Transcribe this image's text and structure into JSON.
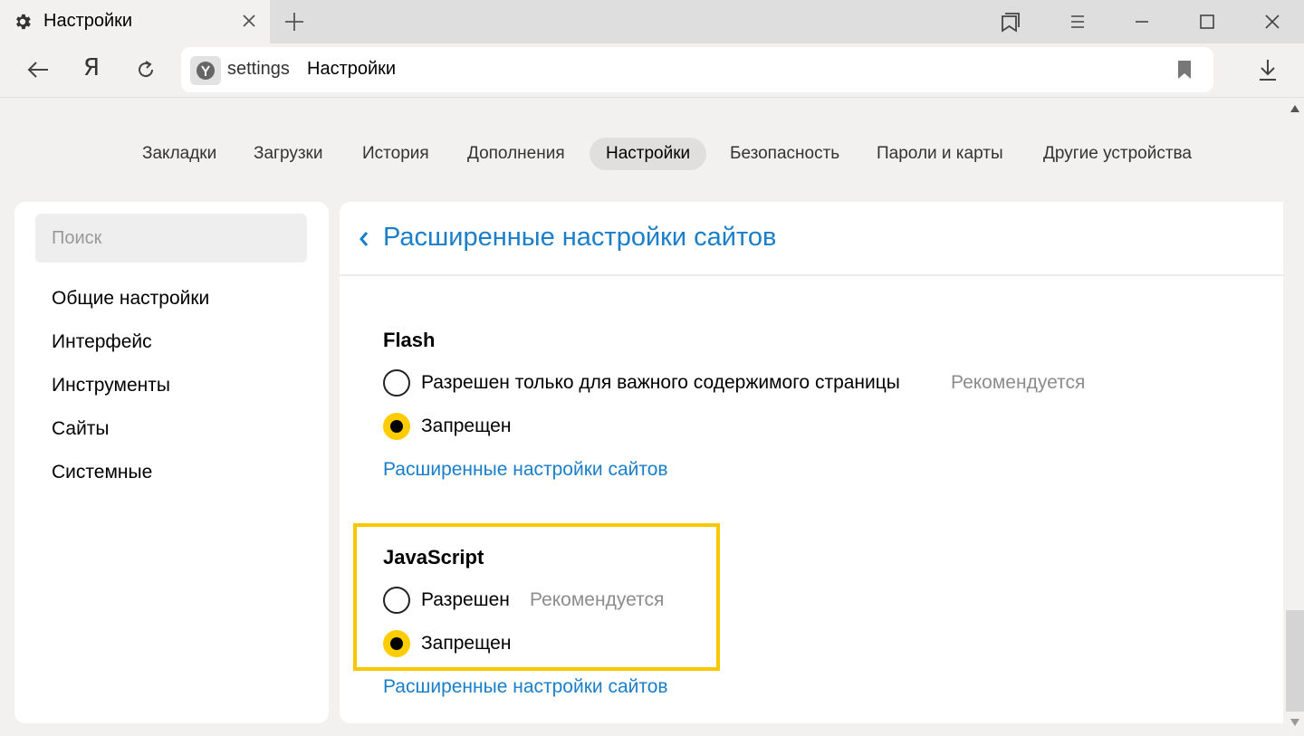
{
  "browser": {
    "tab_title": "Настройки",
    "address_host": "settings",
    "address_title": "Настройки",
    "yandex_button": "Я"
  },
  "nav": {
    "items": [
      {
        "label": "Закладки"
      },
      {
        "label": "Загрузки"
      },
      {
        "label": "История"
      },
      {
        "label": "Дополнения"
      },
      {
        "label": "Настройки",
        "active": true
      },
      {
        "label": "Безопасность"
      },
      {
        "label": "Пароли и карты"
      },
      {
        "label": "Другие устройства"
      }
    ]
  },
  "sidebar": {
    "search_placeholder": "Поиск",
    "items": [
      {
        "label": "Общие настройки"
      },
      {
        "label": "Интерфейс"
      },
      {
        "label": "Инструменты"
      },
      {
        "label": "Сайты"
      },
      {
        "label": "Системные"
      }
    ]
  },
  "main": {
    "title": "Расширенные настройки сайтов",
    "sections": [
      {
        "title": "Flash",
        "options": [
          {
            "label": "Разрешен только для важного содержимого страницы",
            "hint": "Рекомендуется",
            "checked": false
          },
          {
            "label": "Запрещен",
            "hint": "",
            "checked": true
          }
        ],
        "link": "Расширенные настройки сайтов"
      },
      {
        "title": "JavaScript",
        "options": [
          {
            "label": "Разрешен",
            "hint": "Рекомендуется",
            "checked": false
          },
          {
            "label": "Запрещен",
            "hint": "",
            "checked": true
          }
        ],
        "link": "Расширенные настройки сайтов"
      }
    ]
  },
  "colors": {
    "accent_link": "#1a7ec9",
    "radio_checked": "#ffcc00",
    "highlight_frame": "#f7c700"
  }
}
